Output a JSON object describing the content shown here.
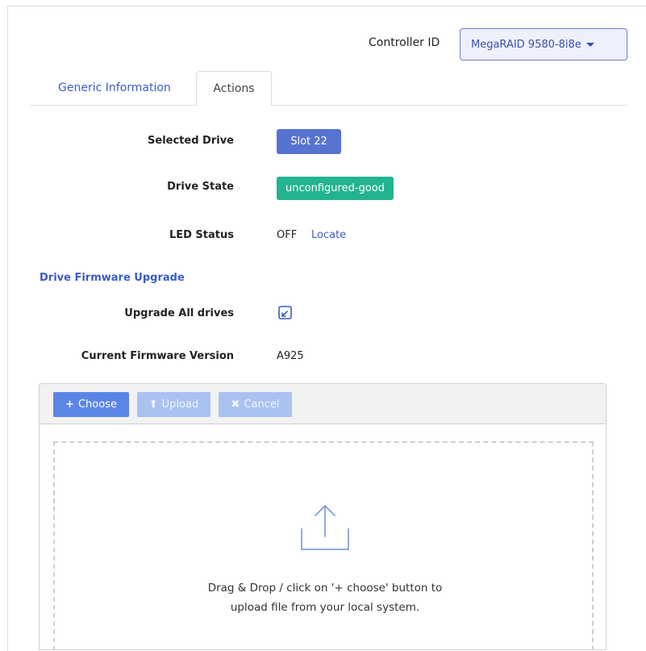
{
  "header": {
    "controller_label": "Controller ID",
    "controller_value": "MegaRAID 9580-8i8e"
  },
  "tabs": [
    {
      "label": "Generic Information"
    },
    {
      "label": "Actions"
    }
  ],
  "fields": {
    "selected_drive_label": "Selected Drive",
    "selected_drive_value": "Slot 22",
    "drive_state_label": "Drive State",
    "drive_state_value": "unconfigured-good",
    "led_status_label": "LED Status",
    "led_status_value": "OFF",
    "locate_link": "Locate",
    "section_title": "Drive Firmware Upgrade",
    "upgrade_all_label": "Upgrade All drives",
    "current_fw_label": "Current Firmware Version",
    "current_fw_value": "A925"
  },
  "uploader": {
    "choose_label": "Choose",
    "upload_label": "Upload",
    "cancel_label": "Cancel",
    "drop_text_line1": "Drag & Drop / click on '+ choose' button to",
    "drop_text_line2": "upload file from your local system."
  },
  "icons": {
    "caret": "chevron-down-icon",
    "upgrade_all": "external-link-icon",
    "upload_arrow": "upload-icon"
  },
  "colors": {
    "primary": "#5873cf",
    "link": "#3b5cc4",
    "success": "#23b38f"
  }
}
